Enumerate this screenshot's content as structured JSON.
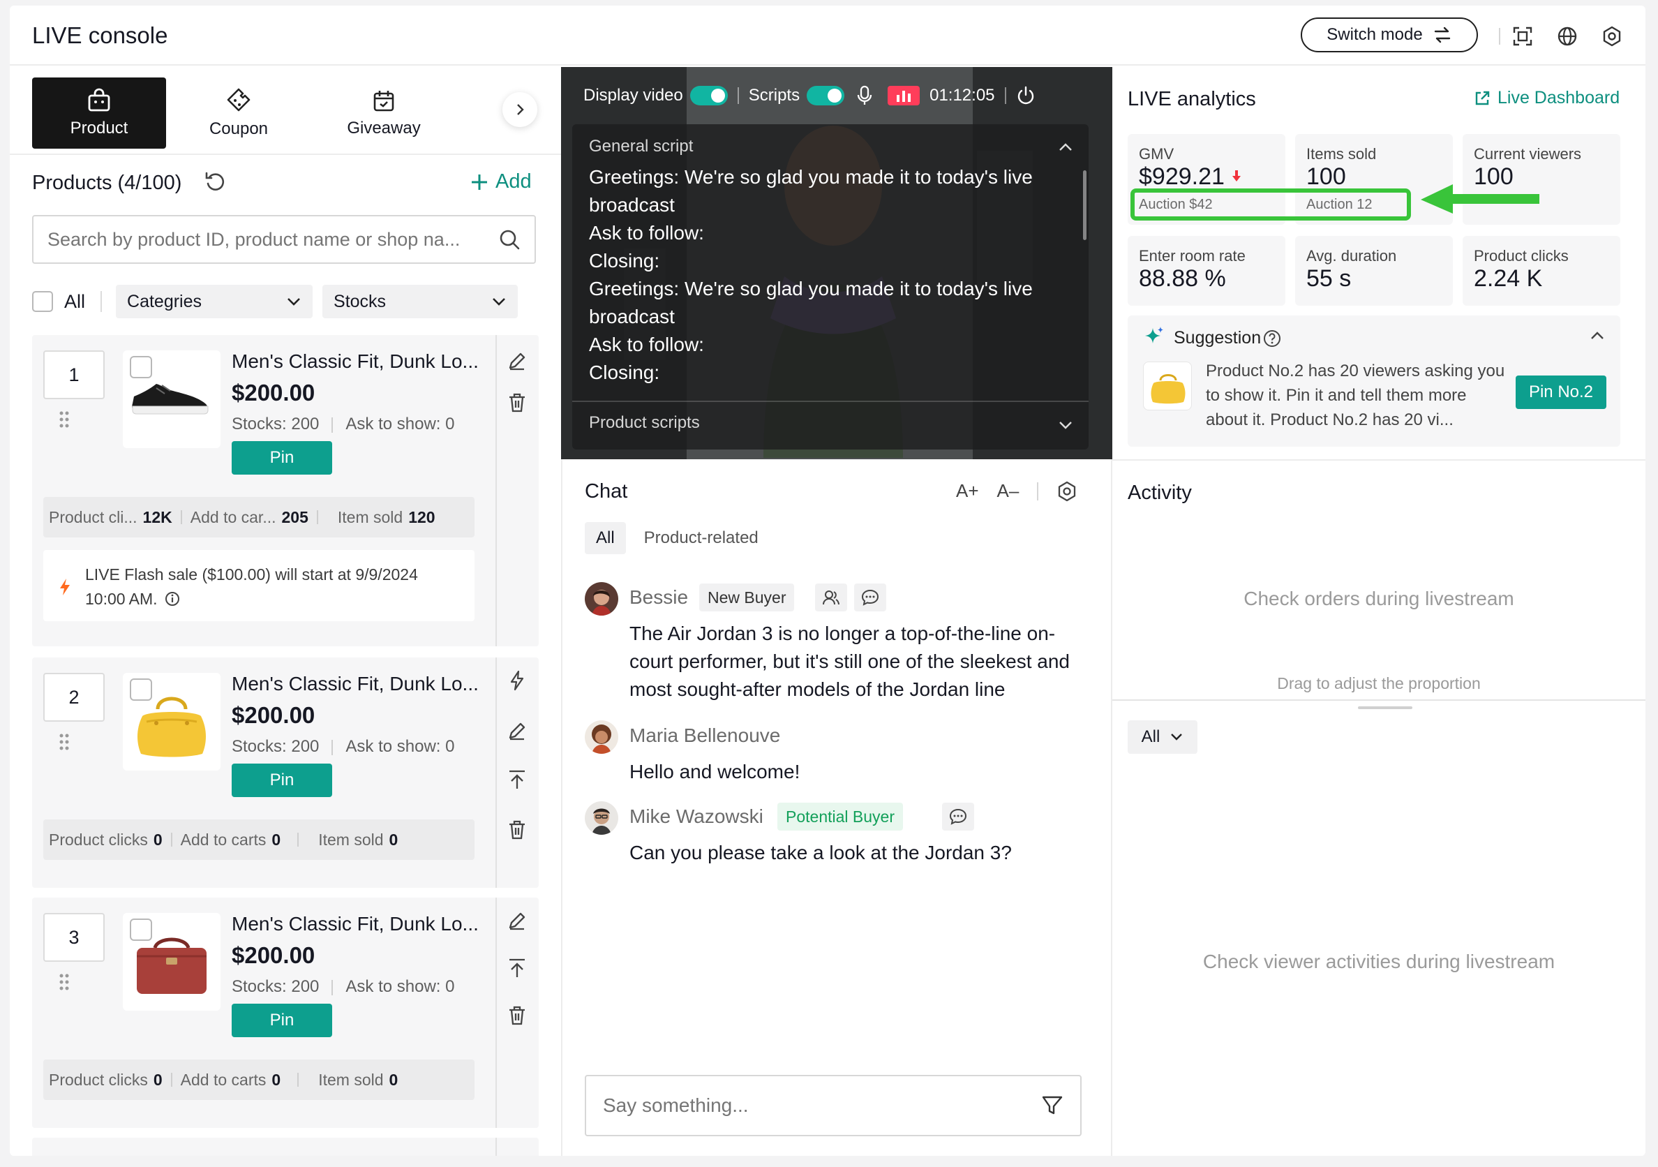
{
  "header": {
    "title": "LIVE console",
    "switch_mode": "Switch mode"
  },
  "left": {
    "tabs": [
      {
        "label": "Product",
        "icon": "shopping-bag-icon"
      },
      {
        "label": "Coupon",
        "icon": "coupon-icon"
      },
      {
        "label": "Giveaway",
        "icon": "giveaway-icon"
      }
    ],
    "products_title": "Products (4/100)",
    "add_label": "Add",
    "search_placeholder": "Search by product ID, product name or shop na...",
    "filter_all": "All",
    "categories_label": "Categries",
    "stocks_label": "Stocks",
    "products": [
      {
        "index": "1",
        "name": "Men's Classic Fit, Dunk Lo...",
        "price": "$200.00",
        "stocks": "Stocks: 200",
        "ask": "Ask to show: 0",
        "pin": "Pin",
        "stat1_label": "Product cli...",
        "stat1_value": "12K",
        "stat2_label": "Add to car...",
        "stat2_value": "205",
        "stat3_label": "Item sold",
        "stat3_value": "120",
        "flash": "LIVE Flash sale ($100.00) will start at 9/9/2024 10:00 AM."
      },
      {
        "index": "2",
        "name": "Men's Classic Fit, Dunk Lo...",
        "price": "$200.00",
        "stocks": "Stocks: 200",
        "ask": "Ask to show: 0",
        "pin": "Pin",
        "stat1_label": "Product clicks",
        "stat1_value": "0",
        "stat2_label": "Add to carts",
        "stat2_value": "0",
        "stat3_label": "Item sold",
        "stat3_value": "0"
      },
      {
        "index": "3",
        "name": "Men's Classic Fit, Dunk Lo...",
        "price": "$200.00",
        "stocks": "Stocks: 200",
        "ask": "Ask to show: 0",
        "pin": "Pin",
        "stat1_label": "Product clicks",
        "stat1_value": "0",
        "stat2_label": "Add to carts",
        "stat2_value": "0",
        "stat3_label": "Item sold",
        "stat3_value": "0"
      }
    ]
  },
  "video": {
    "display_video": "Display video",
    "scripts": "Scripts",
    "timer": "01:12:05",
    "general_script": "General script",
    "script_lines": [
      "Greetings: We're so glad you made it to today's live broadcast",
      "Ask to follow:",
      "Closing:",
      "Greetings: We're so glad you made it to today's live broadcast",
      "Ask to follow:",
      "Closing:"
    ],
    "product_scripts": "Product scripts"
  },
  "chat": {
    "title": "Chat",
    "font_up": "A+",
    "font_down": "A–",
    "tabs": [
      "All",
      "Product-related"
    ],
    "messages": [
      {
        "name": "Bessie",
        "badge": "New Buyer",
        "text": "The Air Jordan 3 is no longer a top-of-the-line on-court performer, but it's still one of the sleekest and most sought-after models of the Jordan line"
      },
      {
        "name": "Maria Bellenouve",
        "text": "Hello and welcome!"
      },
      {
        "name": "Mike Wazowski",
        "badge": "Potential Buyer",
        "text": "Can you please take a look at the Jordan 3?"
      }
    ],
    "input_placeholder": "Say something..."
  },
  "analytics": {
    "title": "LIVE analytics",
    "dashboard_link": "Live Dashboard",
    "gmv_label": "GMV",
    "gmv_value": "$929.21",
    "gmv_sub": "Auction $42",
    "items_label": "Items sold",
    "items_value": "100",
    "items_sub": "Auction 12",
    "viewers_label": "Current viewers",
    "viewers_value": "100",
    "enter_label": "Enter room rate",
    "enter_value": "88.88 %",
    "avg_label": "Avg. duration",
    "avg_value": "55 s",
    "clicks_label": "Product clicks",
    "clicks_value": "2.24 K",
    "suggestion_title": "Suggestion",
    "suggestion_text": "Product No.2 has 20 viewers asking you to show it. Pin it and tell them more about it. Product No.2 has 20 vi...",
    "suggestion_btn": "Pin No.2"
  },
  "activity": {
    "title": "Activity",
    "empty_orders": "Check orders during livestream",
    "drag_hint": "Drag to adjust the proportion",
    "filter": "All",
    "empty_activities": "Check viewer activities during livestream"
  },
  "colors": {
    "accent": "#0d9f8e",
    "highlight": "#39c43a",
    "live_red": "#ff3d5a"
  }
}
